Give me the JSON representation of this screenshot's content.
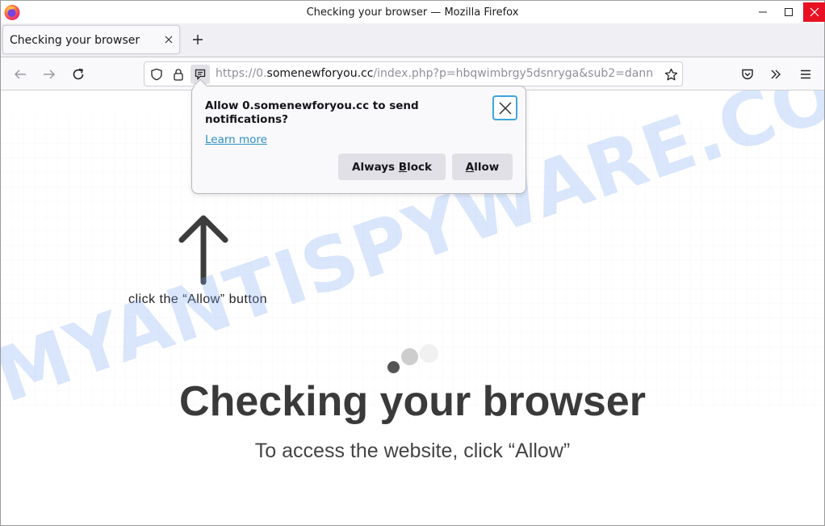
{
  "window": {
    "title": "Checking your browser — Mozilla Firefox",
    "controls": [
      "minimize",
      "maximize",
      "close"
    ],
    "close_color": "#e81123"
  },
  "tabs": [
    {
      "label": "Checking your browser",
      "active": true
    }
  ],
  "navbar": {
    "url_scheme": "https://0.",
    "url_host": "somenewforyou.cc",
    "url_path": "/index.php?p=hbqwimbrgy5dsnryga&sub2=dann",
    "icons": [
      "back-icon",
      "forward-icon",
      "reload-icon",
      "shield-icon",
      "lock-icon",
      "notification-permission-icon",
      "bookmark-star-icon",
      "pocket-icon",
      "overflow-chevrons-icon",
      "hamburger-menu-icon"
    ]
  },
  "popup": {
    "message": "Allow 0.somenewforyou.cc to send notifications?",
    "learn_more": "Learn more",
    "block_prefix": "Always ",
    "block_accel": "B",
    "block_suffix": "lock",
    "allow_accel": "A",
    "allow_suffix": "llow"
  },
  "page": {
    "hint": "click the “Allow” button",
    "headline": "Checking your browser",
    "subline": "To access the website, click “Allow”",
    "watermark": "MYANTISPYWARE.COM",
    "watermark_color": "#78a5f0"
  }
}
